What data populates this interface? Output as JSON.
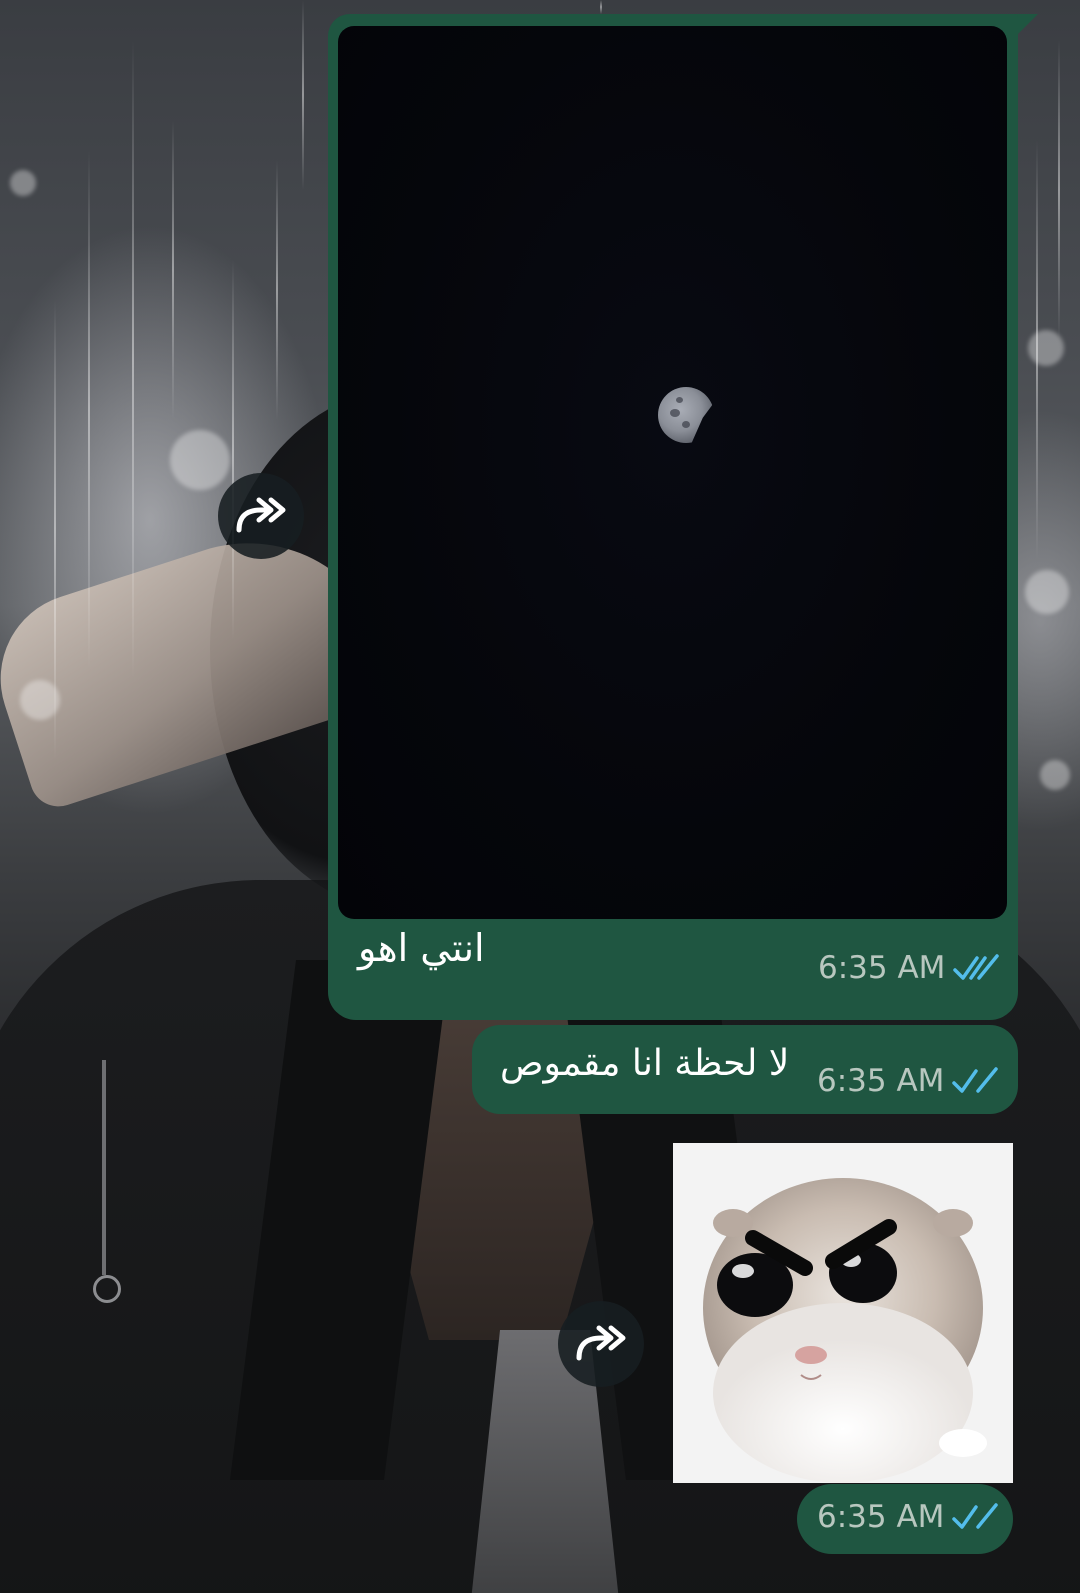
{
  "chat": {
    "messages": [
      {
        "type": "image",
        "image_description": "",
        "caption": "انتي اهو",
        "time": "6:35 AM",
        "status": "read"
      },
      {
        "type": "text",
        "text": "لا لحظة انا مقموص",
        "time": "6:35 AM",
        "status": "read"
      },
      {
        "type": "sticker",
        "time": "6:35 AM",
        "status": "read"
      }
    ],
    "forward_icon": "forward-icon",
    "read_icon": "double-check-icon"
  },
  "colors": {
    "outgoing_bubble": "#1f5641",
    "read_ticks": "#53bdeb",
    "time_text": "#b8c7bf",
    "forward_button": "#171e21"
  }
}
